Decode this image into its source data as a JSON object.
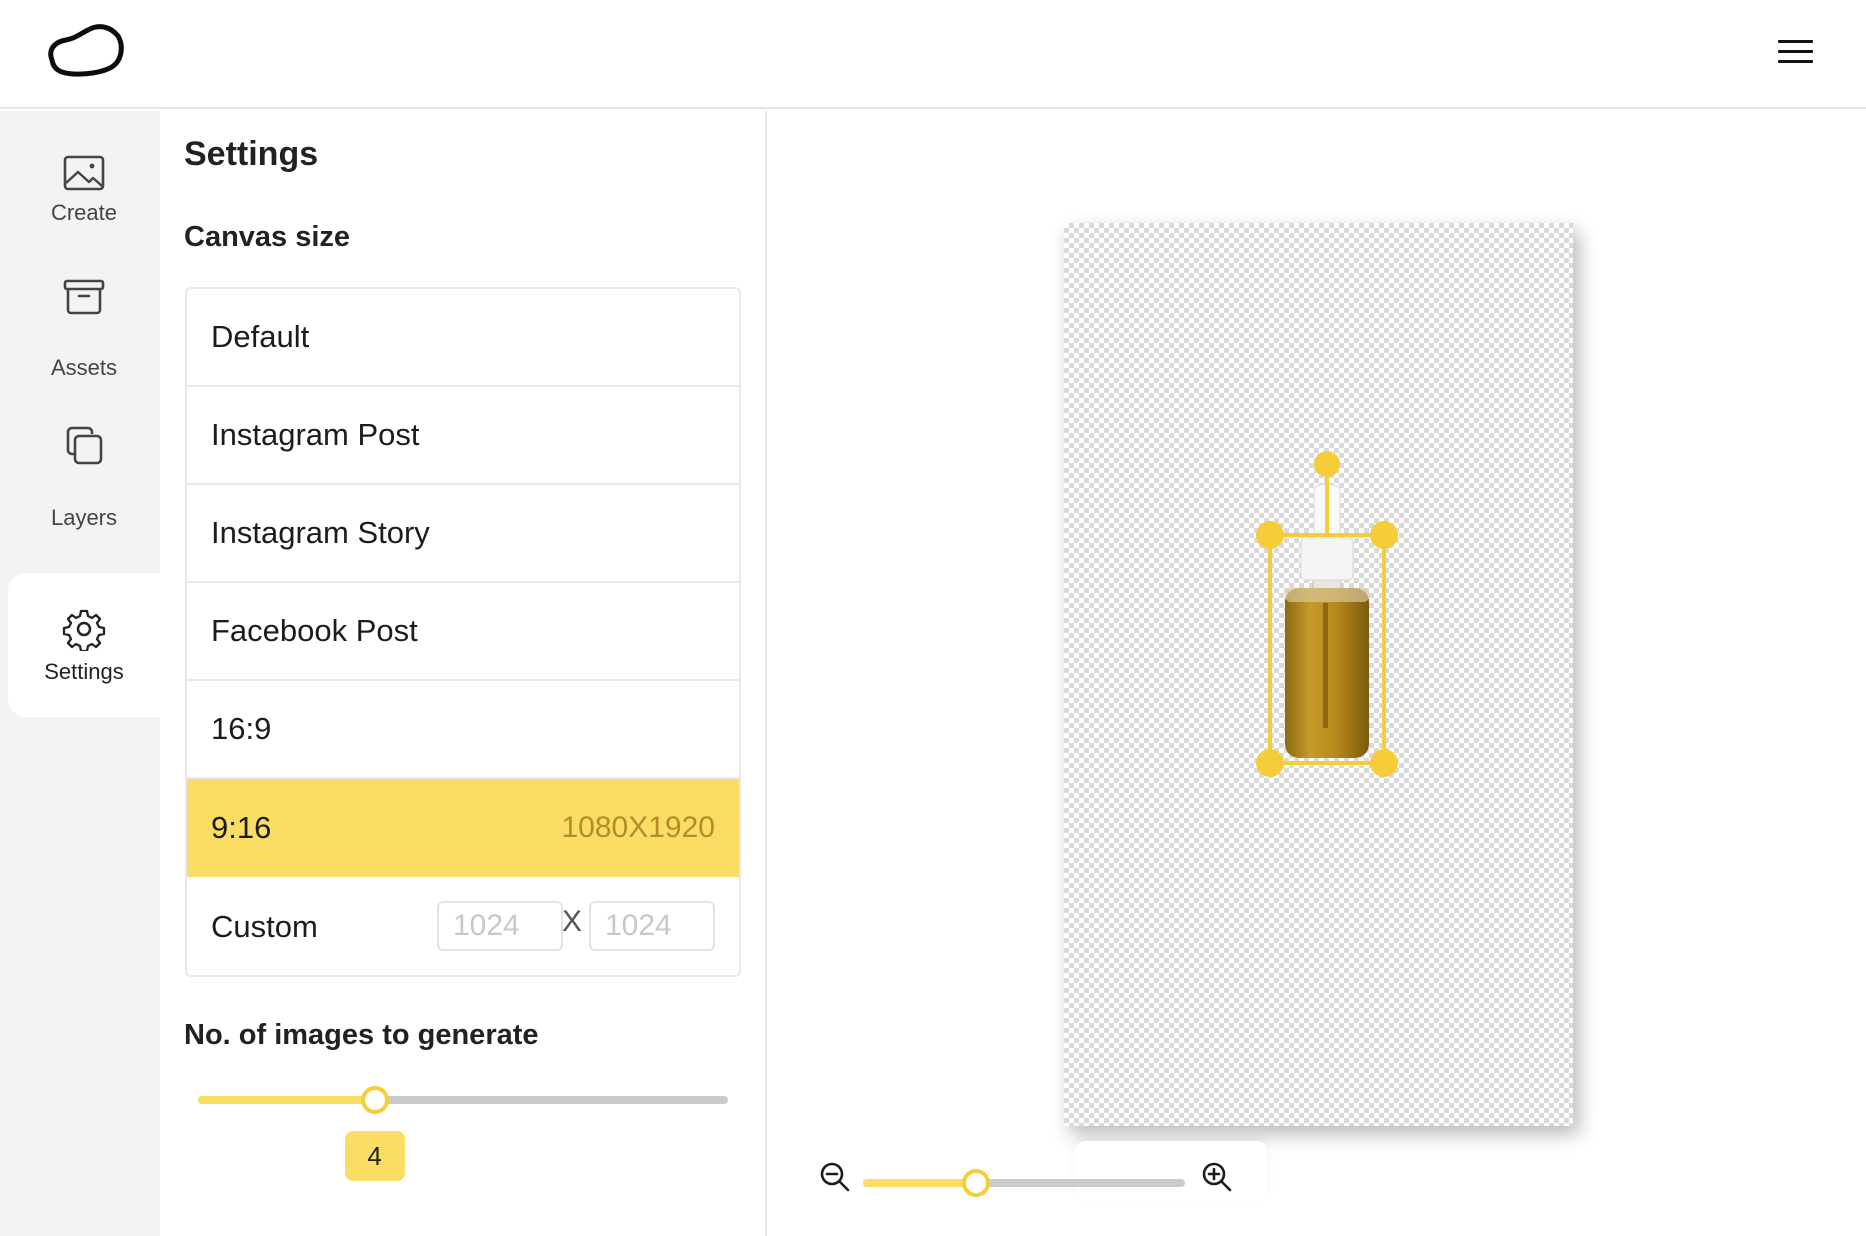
{
  "header": {
    "logo_icon": "cloud-blob-logo",
    "menu_icon": "hamburger-menu-icon"
  },
  "sidebar": {
    "items": [
      {
        "label": "Create",
        "icon": "image-icon",
        "active": false
      },
      {
        "label": "Assets",
        "icon": "archive-box-icon",
        "active": false
      },
      {
        "label": "Layers",
        "icon": "layers-icon",
        "active": false
      },
      {
        "label": "Settings",
        "icon": "gear-icon",
        "active": true
      }
    ]
  },
  "settings": {
    "title": "Settings",
    "canvas_size": {
      "title": "Canvas size",
      "options": [
        {
          "label": "Default",
          "selected": false
        },
        {
          "label": "Instagram Post",
          "selected": false
        },
        {
          "label": "Instagram Story",
          "selected": false
        },
        {
          "label": "Facebook Post",
          "selected": false
        },
        {
          "label": "16:9",
          "selected": false
        },
        {
          "label": "9:16",
          "selected": true,
          "dimensions": "1080X1920"
        }
      ],
      "custom": {
        "label": "Custom",
        "width_placeholder": "1024",
        "height_placeholder": "1024",
        "separator": "X"
      }
    },
    "images_to_generate": {
      "title": "No. of images to generate",
      "value": 4,
      "value_label": "4",
      "min": 1,
      "max": 10
    }
  },
  "stage": {
    "canvas_aspect": "9:16",
    "object": "serum dropper bottle (selected)",
    "zoom": {
      "zoom_out_icon": "zoom-out-icon",
      "zoom_in_icon": "zoom-in-icon",
      "level_fraction": 0.35
    }
  },
  "colors": {
    "accent": "#f9de63",
    "accent_strong": "#f5cd3a",
    "accent_text": "#b8892a",
    "sidebar_bg": "#f3f3f3",
    "border": "#e8e8e8"
  }
}
